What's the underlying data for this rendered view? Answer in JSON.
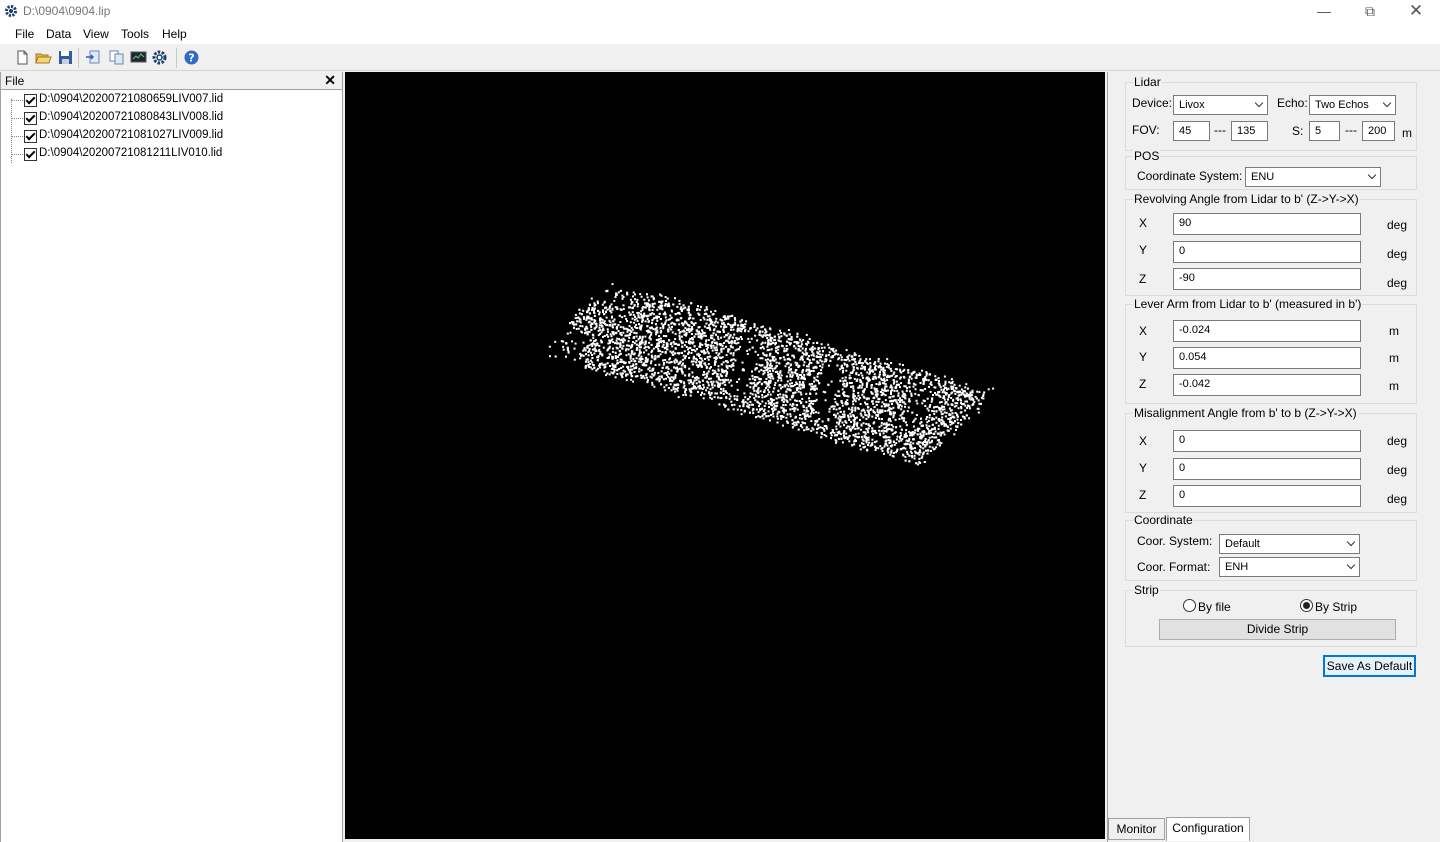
{
  "window": {
    "title": "D:\\0904\\0904.lip"
  },
  "menu": [
    "File",
    "Data",
    "View",
    "Tools",
    "Help"
  ],
  "file_panel": {
    "title": "File",
    "files": [
      "D:\\0904\\20200721080659LIV007.lid",
      "D:\\0904\\20200721080843LIV008.lid",
      "D:\\0904\\20200721081027LIV009.lid",
      "D:\\0904\\20200721081211LIV010.lid"
    ]
  },
  "config": {
    "lidar": {
      "title": "Lidar",
      "device_label": "Device:",
      "device_value": "Livox",
      "echo_label": "Echo:",
      "echo_value": "Two Echos",
      "fov_label": "FOV:",
      "fov_min": "45",
      "fov_sep": "---",
      "fov_max": "135",
      "s_label": "S:",
      "s_min": "5",
      "s_sep": "---",
      "s_max": "200",
      "s_unit": "m"
    },
    "pos": {
      "title": "POS",
      "coord_label": "Coordinate System:",
      "coord_value": "ENU"
    },
    "revolving": {
      "title": "Revolving Angle from Lidar to b' (Z->Y->X)",
      "x": "90",
      "y": "0",
      "z": "-90",
      "unit": "deg"
    },
    "lever": {
      "title": "Lever Arm from Lidar to b' (measured in b')",
      "x": "-0.024",
      "y": "0.054",
      "z": "-0.042",
      "unit": "m"
    },
    "misalign": {
      "title": "Misalignment Angle from b' to b (Z->Y->X)",
      "x": "0",
      "y": "0",
      "z": "0",
      "unit": "deg"
    },
    "axes": {
      "x": "X",
      "y": "Y",
      "z": "Z"
    },
    "coordinate": {
      "title": "Coordinate",
      "system_label": "Coor. System:",
      "system_value": "Default",
      "format_label": "Coor. Format:",
      "format_value": "ENH"
    },
    "strip": {
      "title": "Strip",
      "by_file": "By file",
      "by_strip": "By Strip",
      "selected": "By Strip",
      "divide_button": "Divide Strip"
    },
    "save_default": "Save As Default"
  },
  "tabs": [
    "Monitor",
    "Configuration"
  ],
  "active_tab": "Configuration"
}
